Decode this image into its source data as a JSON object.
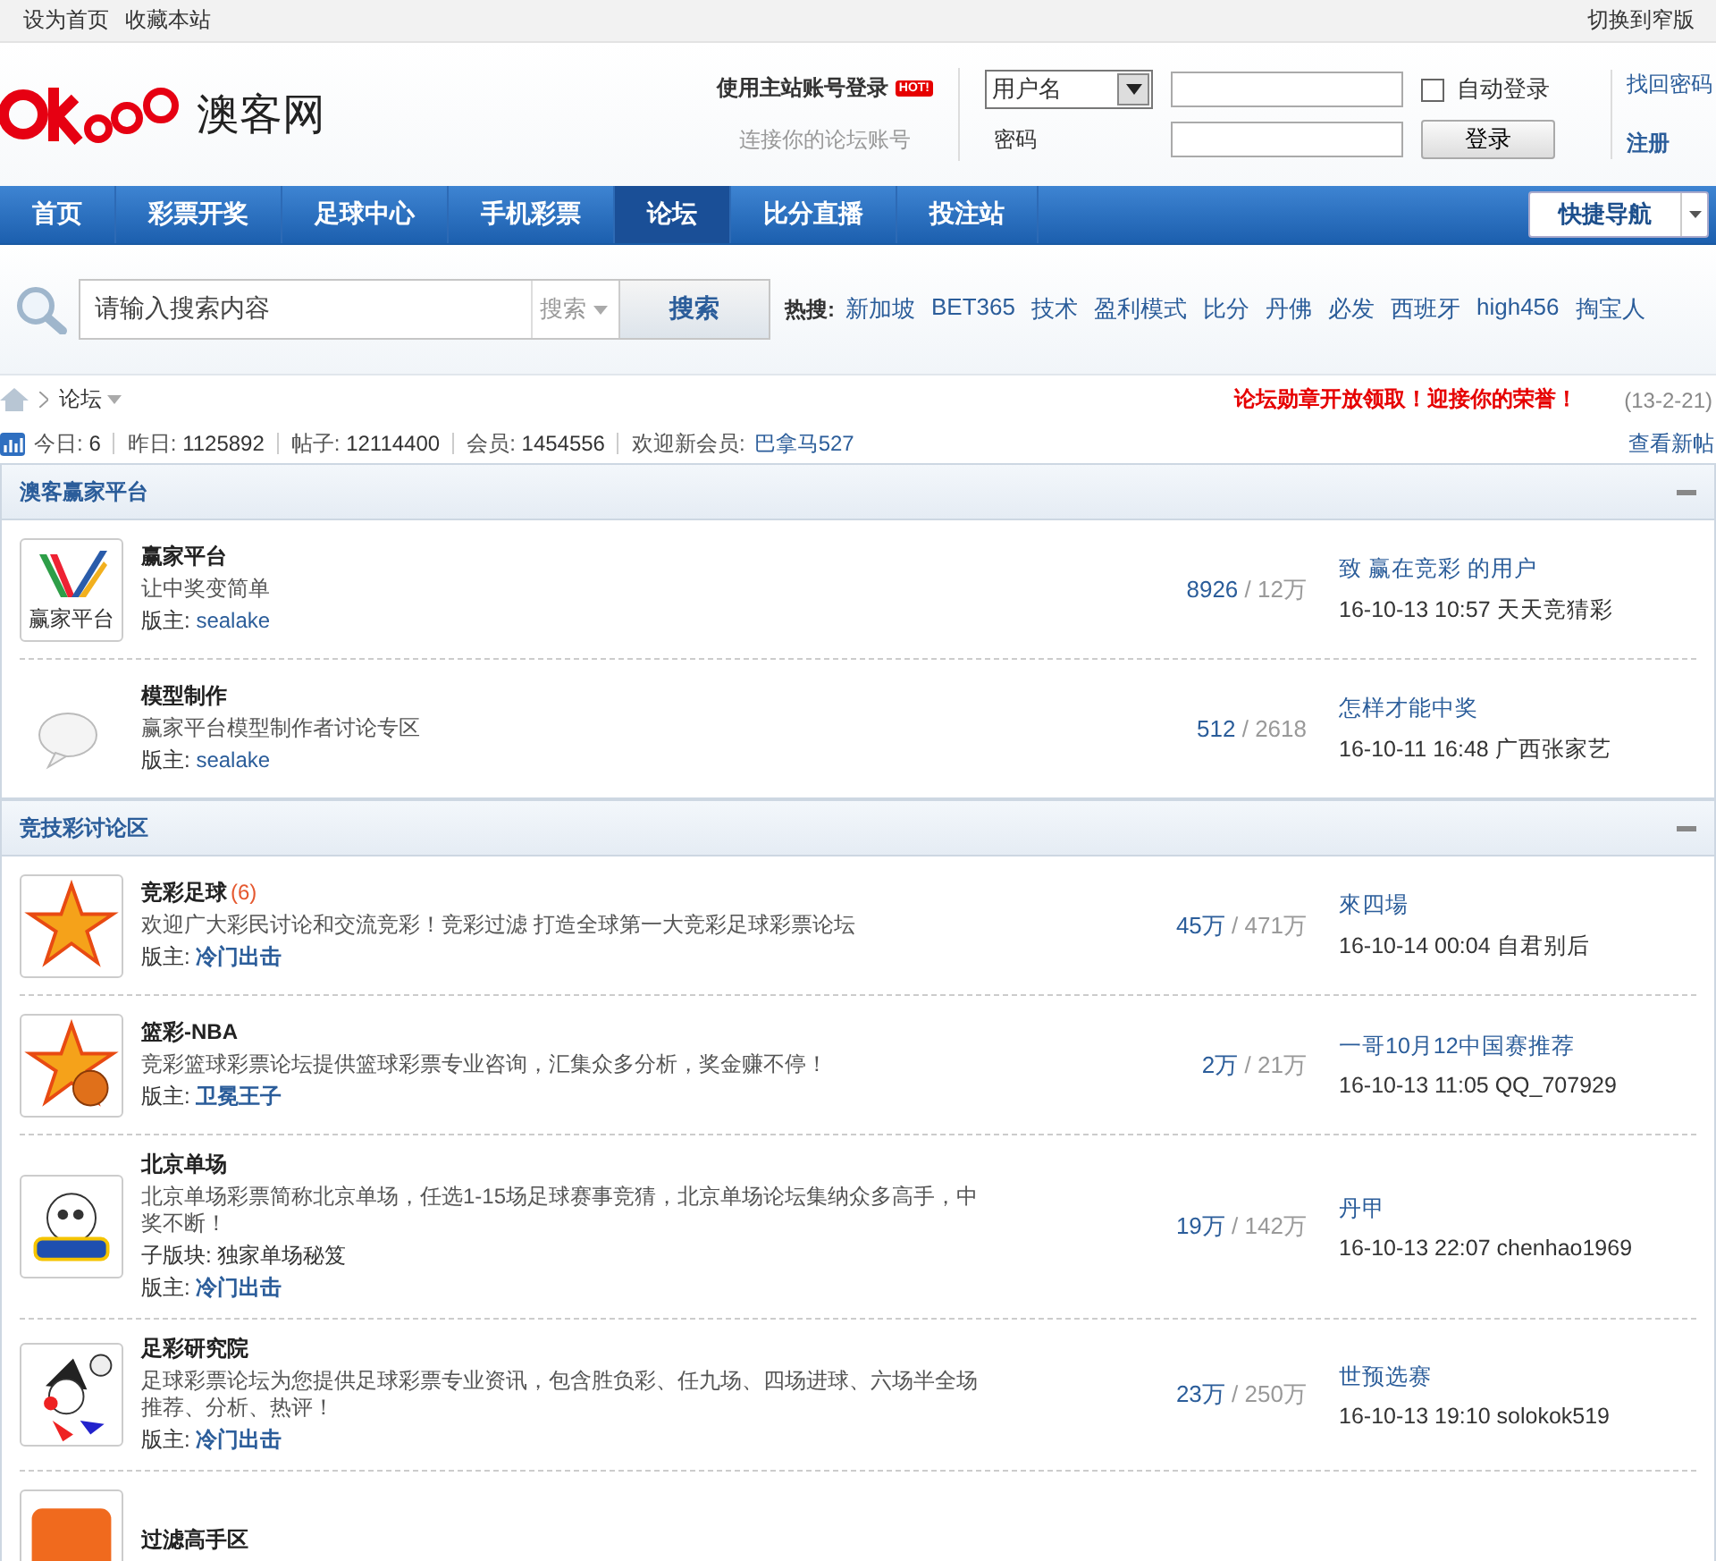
{
  "topbar": {
    "links": [
      "设为首页",
      "收藏本站"
    ],
    "right_link": "切换到窄版"
  },
  "header": {
    "logo_text": "澳客网",
    "login_title": "使用主站账号登录",
    "hot_badge": "HOT!",
    "login_sub": "连接你的论坛账号",
    "username_select": "用户名",
    "password_label": "密码",
    "auto_login": {
      "label": "自动登录",
      "checked": false
    },
    "login_button": "登录",
    "links": [
      "找回密码",
      "注册"
    ]
  },
  "nav": {
    "items": [
      {
        "label": "首页",
        "selected": false
      },
      {
        "label": "彩票开奖",
        "selected": false
      },
      {
        "label": "足球中心",
        "selected": false
      },
      {
        "label": "手机彩票",
        "selected": false
      },
      {
        "label": "论坛",
        "selected": true
      },
      {
        "label": "比分直播",
        "selected": false
      },
      {
        "label": "投注站",
        "selected": false
      }
    ],
    "quick_nav": "快捷导航"
  },
  "search": {
    "placeholder": "请输入搜索内容",
    "type_select": "搜索",
    "button": "搜索",
    "hot_label": "热搜:",
    "hot_terms": [
      "新加坡",
      "BET365",
      "技术",
      "盈利模式",
      "比分",
      "丹佛",
      "必发",
      "西班牙",
      "high456",
      "掏宝人"
    ]
  },
  "breadcrumb": {
    "current": "论坛",
    "notice": "论坛勋章开放领取！迎接你的荣誉！",
    "date": "(13-2-21)"
  },
  "stats": {
    "items": [
      {
        "label": "今日:",
        "value": "6"
      },
      {
        "label": "昨日:",
        "value": "1125892"
      },
      {
        "label": "帖子:",
        "value": "12114400"
      },
      {
        "label": "会员:",
        "value": "1454556"
      }
    ],
    "welcome_label": "欢迎新会员:",
    "new_member": "巴拿马527",
    "view_new": "查看新帖"
  },
  "sections": [
    {
      "title": "澳客赢家平台",
      "expanded": true,
      "forums": [
        {
          "kind": "winner",
          "name": "赢家平台",
          "desc": "让中奖变简单",
          "mod_label": "版主:",
          "moderator": "sealake",
          "mod_bold": false,
          "threads": "8926",
          "slash": "/",
          "posts": "12万",
          "last_title": "致 赢在竞彩 的用户",
          "last_meta": "16-10-13 10:57 天天竞猜彩",
          "icon_text": "赢家平台"
        },
        {
          "kind": "bubble",
          "name": "模型制作",
          "desc": "赢家平台模型制作者讨论专区",
          "mod_label": "版主:",
          "moderator": "sealake",
          "mod_bold": false,
          "threads": "512",
          "slash": "/",
          "posts": "2618",
          "last_title": "怎样才能中奖",
          "last_meta": "16-10-11 16:48 广西张家艺"
        }
      ]
    },
    {
      "title": "竞技彩讨论区",
      "expanded": true,
      "forums": [
        {
          "kind": "star",
          "name": "竞彩足球",
          "today": "(6)",
          "desc": "欢迎广大彩民讨论和交流竞彩！竞彩过滤 打造全球第一大竞彩足球彩票论坛",
          "mod_label": "版主:",
          "moderator": "冷门出击",
          "mod_bold": true,
          "threads": "45万",
          "slash": "/",
          "posts": "471万",
          "last_title": "來四場",
          "last_meta": "16-10-14 00:04 自君别后"
        },
        {
          "kind": "star_ball",
          "name": "篮彩-NBA",
          "desc": "竞彩篮球彩票论坛提供篮球彩票专业咨询，汇集众多分析，奖金赚不停！",
          "mod_label": "版主:",
          "moderator": "卫冕王子",
          "mod_bold": true,
          "threads": "2万",
          "slash": "/",
          "posts": "21万",
          "last_title": "一哥10月12中国赛推荐",
          "last_meta": "16-10-13 11:05 QQ_707929"
        },
        {
          "kind": "mascot",
          "name": "北京单场",
          "desc": "北京单场彩票简称北京单场，任选1-15场足球赛事竞猜，北京单场论坛集纳众多高手，中奖不断！",
          "sub_label": "子版块:",
          "sub_forum": "独家单场秘笈",
          "mod_label": "版主:",
          "moderator": "冷门出击",
          "mod_bold": true,
          "threads": "19万",
          "slash": "/",
          "posts": "142万",
          "last_title": "丹甲",
          "last_meta": "16-10-13 22:07 chenhao1969"
        },
        {
          "kind": "clown",
          "name": "足彩研究院",
          "desc": "足球彩票论坛为您提供足球彩票专业资讯，包含胜负彩、任九场、四场进球、六场半全场推荐、分析、热评！",
          "mod_label": "版主:",
          "moderator": "冷门出击",
          "mod_bold": true,
          "threads": "23万",
          "slash": "/",
          "posts": "250万",
          "last_title": "世预选赛",
          "last_meta": "16-10-13 19:10 solokok519"
        },
        {
          "kind": "square",
          "name": "过滤高手区"
        }
      ]
    }
  ]
}
